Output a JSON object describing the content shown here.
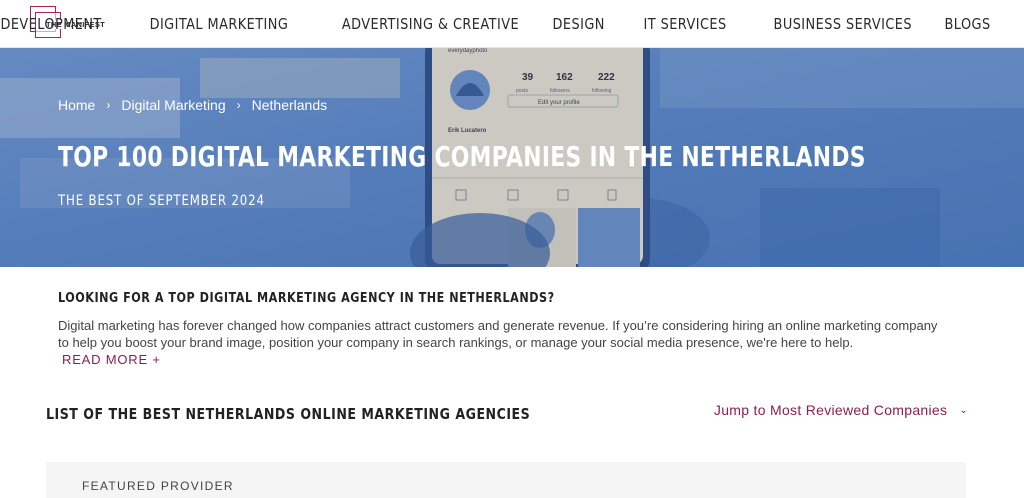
{
  "header": {
    "logo_text": "THE MANIFEST",
    "nav": [
      "DEVELOPMENT",
      "DIGITAL MARKETING",
      "ADVERTISING & CREATIVE",
      "DESIGN",
      "IT SERVICES",
      "BUSINESS SERVICES",
      "BLOGS"
    ]
  },
  "hero": {
    "breadcrumb": [
      "Home",
      "Digital Marketing",
      "Netherlands"
    ],
    "title": "TOP 100 DIGITAL MARKETING COMPANIES IN THE NETHERLANDS",
    "subtitle": "THE BEST OF SEPTEMBER 2024",
    "phone": {
      "stats": [
        "39",
        "162",
        "222"
      ],
      "stat_labels": [
        "posts",
        "followers",
        "following"
      ],
      "edit_profile": "Edit your profile",
      "name": "Erik Lucatero",
      "handle": "everydayphoto"
    }
  },
  "intro": {
    "title": "LOOKING FOR A TOP DIGITAL MARKETING AGENCY IN THE NETHERLANDS?",
    "text": "Digital marketing has forever changed how companies attract customers and generate revenue. If you’re considering hiring an online marketing company to help you boost your brand image, position your company in search rankings, or manage your social media presence, we're here to help.",
    "read_more": "READ MORE +"
  },
  "list": {
    "title": "LIST OF THE BEST NETHERLANDS ONLINE MARKETING AGENCIES",
    "jump_label": "Jump to Most Reviewed Companies"
  },
  "featured": {
    "label": "FEATURED PROVIDER"
  },
  "colors": {
    "brand": "#8c1f4f",
    "hero_blue": "#5f88c4"
  }
}
